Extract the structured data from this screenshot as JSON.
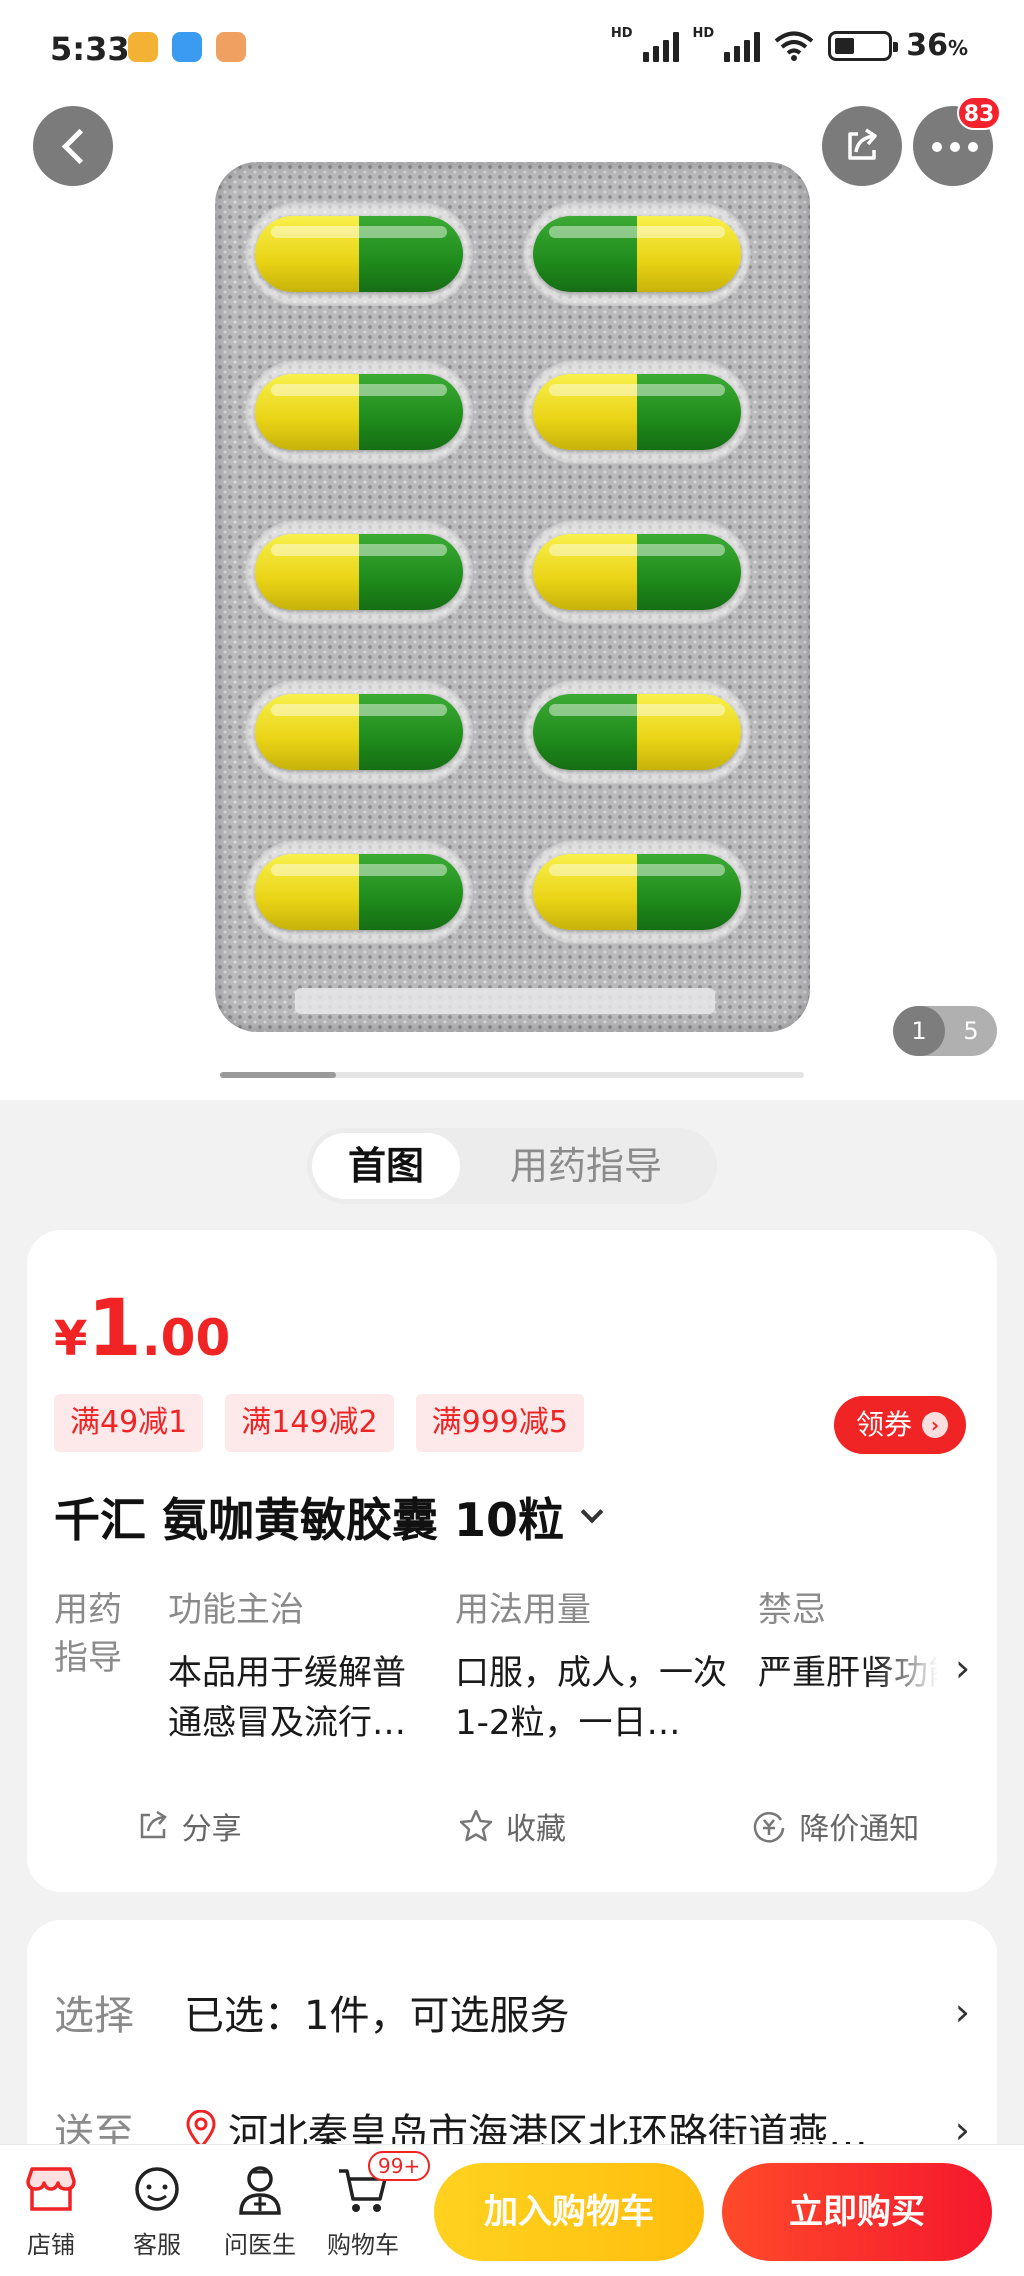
{
  "status_bar": {
    "time": "5:33",
    "battery": "36",
    "battery_unit": "%",
    "battery_level": 0.36,
    "network_label": "HD",
    "icons": [
      "notification-app-icon",
      "notification-app-icon",
      "notification-app-icon",
      "signal-icon",
      "signal-icon",
      "wifi-icon",
      "battery-icon"
    ]
  },
  "gallery": {
    "current_page": "1",
    "total_pages": "5",
    "more_badge": "83",
    "capsule_colors": {
      "yellow": "#f0dc1e",
      "green": "#1f8b1c"
    },
    "icons": [
      "back-arrow-icon",
      "share-icon",
      "more-icon"
    ]
  },
  "tabs": {
    "primary": "首图",
    "secondary": "用药指导"
  },
  "product": {
    "price_symbol": "¥",
    "price_integer": "1",
    "price_decimal": ".00",
    "coupons": [
      "满49减1",
      "满149减2",
      "满999减5"
    ],
    "get_coupon_label": "领券",
    "title": "千汇 氨咖黄敏胶囊 10粒",
    "accent_color": "#f02424"
  },
  "guide": {
    "label": "用药指导",
    "columns": [
      {
        "head": "功能主治",
        "body": "本品用于缓解普通感冒及流行…"
      },
      {
        "head": "用法用量",
        "body": "口服，成人，一次1-2粒，一日…"
      },
      {
        "head": "禁忌",
        "body": "严重肝肾功能不全者禁用。"
      }
    ]
  },
  "actions": {
    "share": "分享",
    "favorite": "收藏",
    "price_alert": "降价通知"
  },
  "selection": {
    "select_label": "选择",
    "select_value": "已选：1件，可选服务",
    "ship_label": "送至",
    "ship_value": "河北秦皇岛市海港区北环路街道燕…"
  },
  "bottom_bar": {
    "store": "店铺",
    "service": "客服",
    "doctor": "问医生",
    "cart": "购物车",
    "cart_badge": "99+",
    "add_to_cart": "加入购物车",
    "buy_now": "立即购买"
  }
}
